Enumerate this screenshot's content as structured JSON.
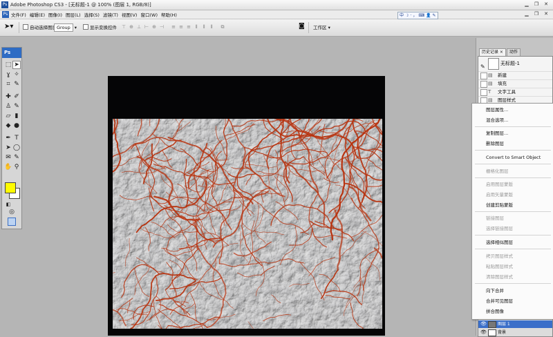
{
  "window": {
    "title": "Adobe Photoshop CS3 - [无标题-1 @ 100% (图层 1, RGB/8)]",
    "app_icon": "Ps"
  },
  "menubar": {
    "icon": "Ps",
    "items": [
      "文件(F)",
      "编辑(E)",
      "图像(I)",
      "图层(L)",
      "选择(S)",
      "滤镜(T)",
      "视图(V)",
      "窗口(W)",
      "帮助(H)"
    ]
  },
  "ime_bar": [
    "中",
    "☽",
    "·",
    "，",
    "⌨",
    "👤",
    "✎"
  ],
  "options_bar": {
    "auto_select_label": "自动选择图层",
    "auto_select_value": "Group",
    "transform_label": "显示变换控件",
    "workspace_label": "工作区 ▾"
  },
  "toolbox": {
    "logo": "Ps"
  },
  "panel_tabs": [
    "历史记录 ×",
    "动作"
  ],
  "history": {
    "snapshot": "无标题-1",
    "items": [
      "新建",
      "填充",
      "文字工具",
      "图层样式"
    ]
  },
  "context_menu": {
    "items": [
      {
        "label": "图层属性...",
        "disabled": false
      },
      {
        "label": "混合选项...",
        "disabled": false
      },
      {
        "label": "复制图层...",
        "disabled": false
      },
      {
        "label": "删除图层",
        "disabled": false
      },
      {
        "label": "Convert to Smart Object",
        "disabled": false
      },
      {
        "label": "栅格化图层",
        "disabled": true
      },
      {
        "label": "启用图层蒙版",
        "disabled": true
      },
      {
        "label": "启用矢量蒙版",
        "disabled": true
      },
      {
        "label": "创建剪贴蒙版",
        "disabled": false
      },
      {
        "label": "链接图层",
        "disabled": true
      },
      {
        "label": "选择链接图层",
        "disabled": true
      },
      {
        "label": "选择相似图层",
        "disabled": false
      },
      {
        "label": "拷贝图层样式",
        "disabled": true
      },
      {
        "label": "粘贴图层样式",
        "disabled": true
      },
      {
        "label": "清除图层样式",
        "disabled": true
      },
      {
        "label": "向下合并",
        "disabled": false
      },
      {
        "label": "合并可见图层",
        "disabled": false
      },
      {
        "label": "拼合图像",
        "disabled": false
      }
    ]
  },
  "layers": [
    {
      "label": "图层 1",
      "selected": true
    },
    {
      "label": "背景",
      "selected": false
    }
  ]
}
